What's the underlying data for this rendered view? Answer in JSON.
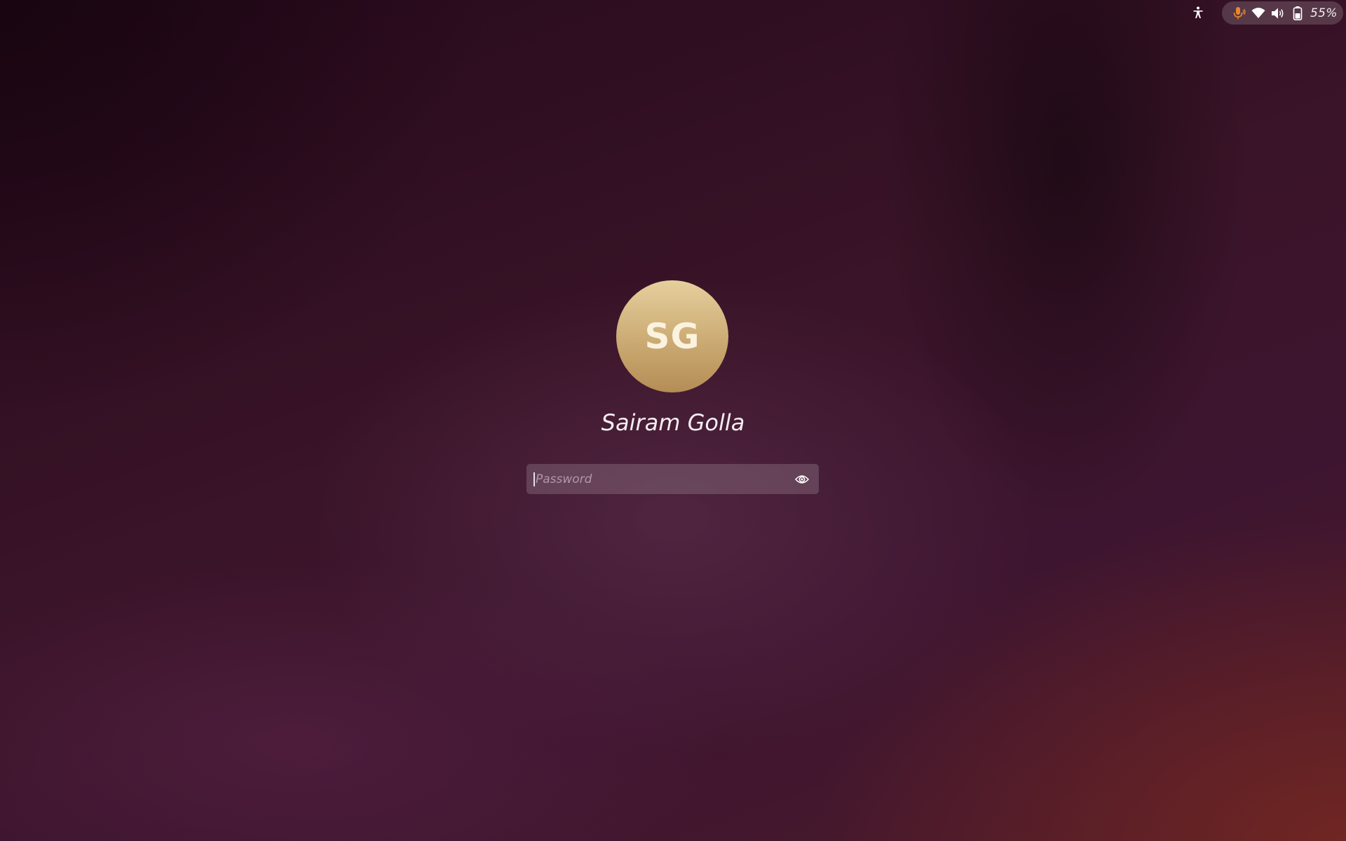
{
  "top_bar": {
    "accessibility_icon": "accessibility-icon",
    "status_icons": [
      "microphone-icon",
      "wifi-icon",
      "volume-icon",
      "battery-icon"
    ],
    "battery_percent": "55%",
    "mic_color": "#e8862c"
  },
  "login": {
    "avatar_initials": "SG",
    "user_name": "Sairam Golla",
    "password_placeholder": "Password",
    "password_value": "",
    "reveal_icon": "eye-icon"
  },
  "colors": {
    "avatar_top": "#e6cf9d",
    "avatar_bottom": "#b48d55",
    "background": "#3a1428"
  }
}
